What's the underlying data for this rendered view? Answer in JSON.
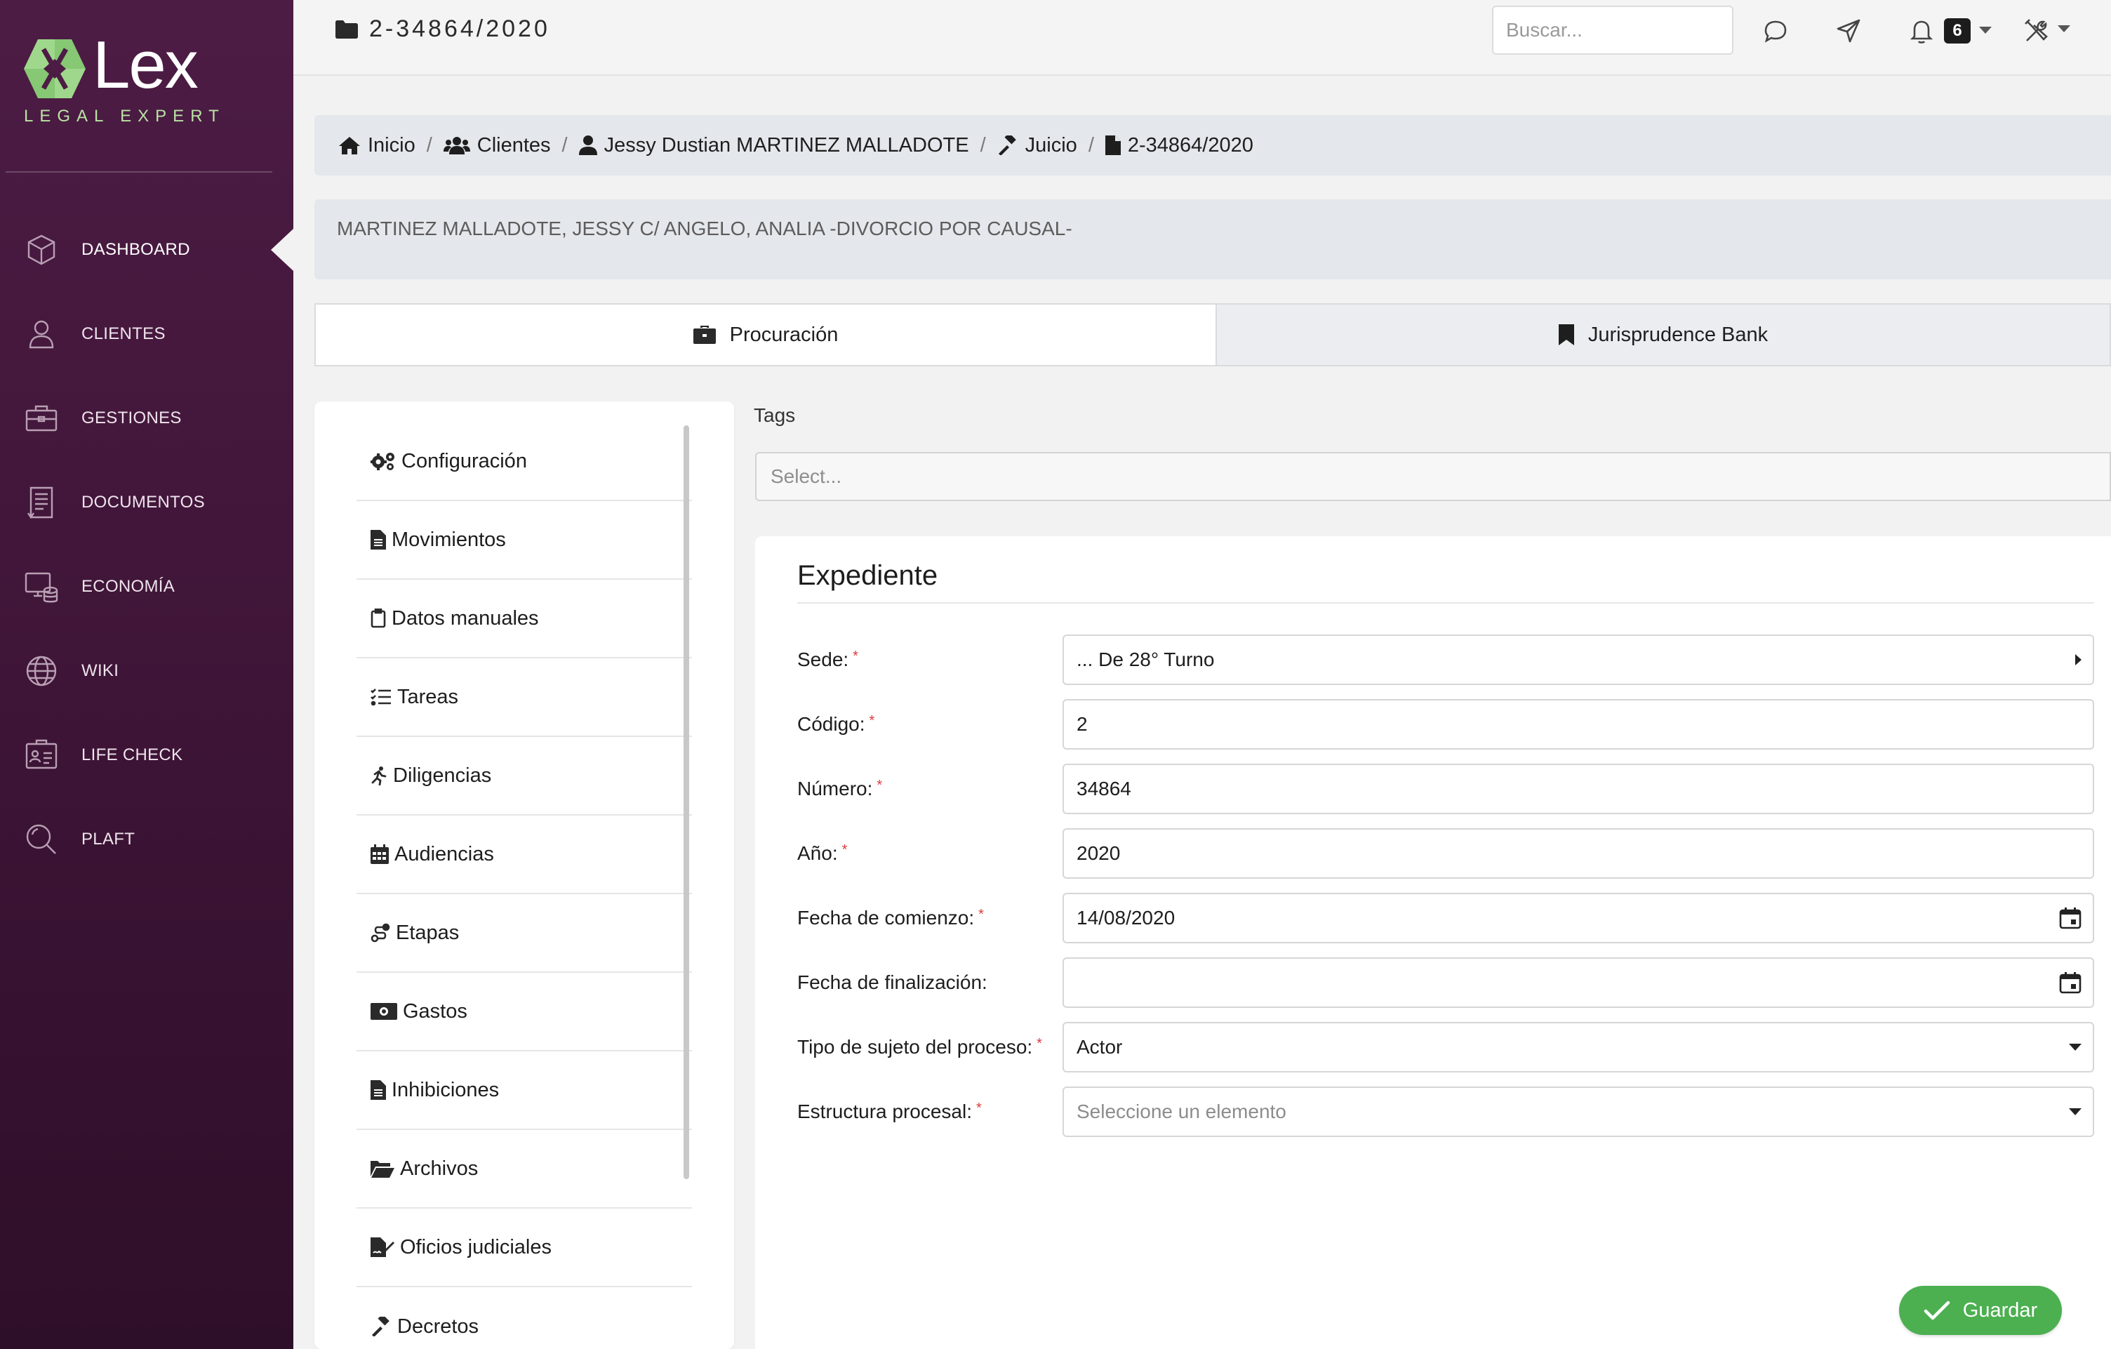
{
  "brand": {
    "name": "Lex",
    "tagline": "LEGAL EXPERT",
    "accent": "#b9e3a3"
  },
  "sidebar": {
    "items": [
      {
        "label": "DASHBOARD",
        "icon": "cube-icon",
        "active": true
      },
      {
        "label": "CLIENTES",
        "icon": "user-icon"
      },
      {
        "label": "GESTIONES",
        "icon": "briefcase-icon"
      },
      {
        "label": "DOCUMENTOS",
        "icon": "document-icon"
      },
      {
        "label": "ECONOMÍA",
        "icon": "economy-icon"
      },
      {
        "label": "WIKI",
        "icon": "globe-icon"
      },
      {
        "label": "LIFE CHECK",
        "icon": "id-card-icon"
      },
      {
        "label": "PLAFT",
        "icon": "magnifier-icon"
      }
    ]
  },
  "topbar": {
    "case_number": "2-34864/2020",
    "search_placeholder": "Buscar...",
    "notification_count": "6"
  },
  "breadcrumb": {
    "items": [
      {
        "label": "Inicio",
        "icon": "home-icon"
      },
      {
        "label": "Clientes",
        "icon": "users-icon"
      },
      {
        "label": "Jessy Dustian MARTINEZ MALLADOTE",
        "icon": "person-icon"
      },
      {
        "label": "Juicio",
        "icon": "gavel-icon"
      },
      {
        "label": "2-34864/2020",
        "icon": "file-icon"
      }
    ]
  },
  "case_caption": "MARTINEZ MALLADOTE, JESSY C/ ANGELO, ANALIA -DIVORCIO POR CAUSAL-",
  "tabs": [
    {
      "label": "Procuración",
      "icon": "briefcase-icon",
      "active": true
    },
    {
      "label": "Jurisprudence Bank",
      "icon": "bookmark-icon",
      "active": false
    }
  ],
  "menu": {
    "items": [
      {
        "label": "Configuración",
        "icon": "cogs-icon"
      },
      {
        "label": "Movimientos",
        "icon": "file-text-icon"
      },
      {
        "label": "Datos manuales",
        "icon": "clipboard-icon"
      },
      {
        "label": "Tareas",
        "icon": "tasks-icon"
      },
      {
        "label": "Diligencias",
        "icon": "running-icon"
      },
      {
        "label": "Audiencias",
        "icon": "calendar-icon"
      },
      {
        "label": "Etapas",
        "icon": "route-icon"
      },
      {
        "label": "Gastos",
        "icon": "money-icon"
      },
      {
        "label": "Inhibiciones",
        "icon": "file-text-icon"
      },
      {
        "label": "Archivos",
        "icon": "folder-open-icon"
      },
      {
        "label": "Oficios judiciales",
        "icon": "file-signature-icon"
      },
      {
        "label": "Decretos",
        "icon": "gavel-icon"
      }
    ]
  },
  "tags": {
    "label": "Tags",
    "placeholder": "Select..."
  },
  "form": {
    "title": "Expediente",
    "fields": [
      {
        "label": "Sede:",
        "required": true,
        "value": "... De 28° Turno",
        "kind": "tree-select"
      },
      {
        "label": "Código:",
        "required": true,
        "value": "2",
        "kind": "text"
      },
      {
        "label": "Número:",
        "required": true,
        "value": "34864",
        "kind": "text"
      },
      {
        "label": "Año:",
        "required": true,
        "value": "2020",
        "kind": "text"
      },
      {
        "label": "Fecha de comienzo:",
        "required": true,
        "value": "14/08/2020",
        "kind": "date"
      },
      {
        "label": "Fecha de finalización:",
        "required": false,
        "value": "",
        "kind": "date"
      },
      {
        "label": "Tipo de sujeto del proceso:",
        "required": true,
        "value": "Actor",
        "kind": "select"
      },
      {
        "label": "Estructura procesal:",
        "required": true,
        "value": "",
        "placeholder": "Seleccione un elemento",
        "kind": "select"
      }
    ],
    "required_marker": "*"
  },
  "save_button": {
    "label": "Guardar",
    "color": "#4caf50"
  }
}
